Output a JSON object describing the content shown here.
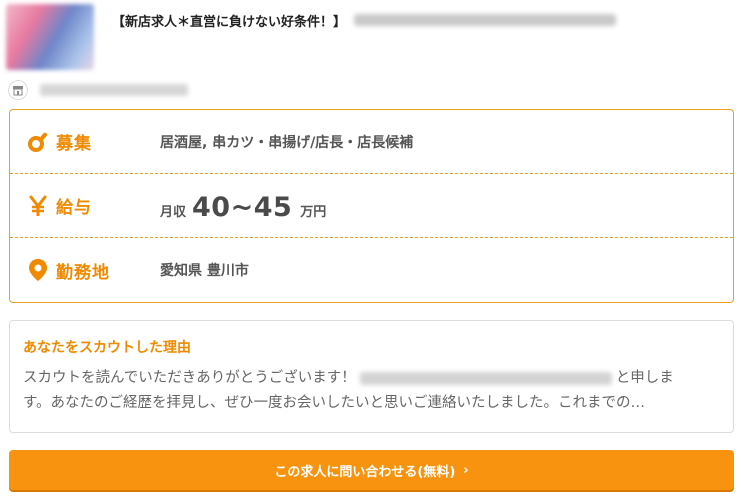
{
  "job": {
    "title": "【新店求人＊直営に負けない好条件！】"
  },
  "details": {
    "recruit": {
      "label": "募集",
      "value": "居酒屋, 串カツ・串揚げ/店長・店長候補",
      "icon": "frying-pan-icon"
    },
    "salary": {
      "label": "給与",
      "prefix": "月収",
      "amount": "40~45",
      "unit": "万円",
      "icon": "yen-icon"
    },
    "location": {
      "label": "勤務地",
      "value": "愛知県 豊川市",
      "icon": "map-pin-icon"
    }
  },
  "scout": {
    "title": "あなたをスカウトした理由",
    "line1_start": "スカウトを読んでいただきありがとうございます！",
    "line1_end": "と申しま",
    "line2": "す。あなたのご経歴を拝見し、ぜひ一度お会いしたいと思いご連絡いたしました。これまでの…"
  },
  "cta": {
    "label": "この求人に問い合わせる(無料)",
    "chevron": "›"
  },
  "colors": {
    "accent": "#f08a00",
    "cta": "#f7930e",
    "border": "#f0a020"
  }
}
